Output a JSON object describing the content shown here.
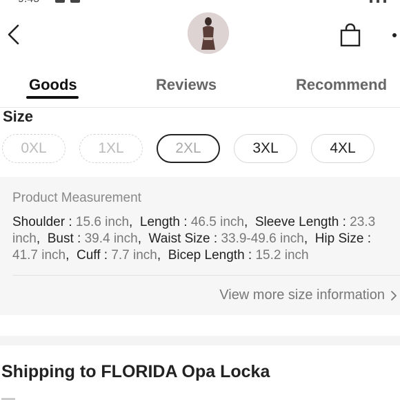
{
  "status_bar": {
    "time": "9:45"
  },
  "header": {
    "back_icon": "chevron-left-icon",
    "avatar_icon": "product-thumbnail",
    "bag_icon": "shopping-bag-icon",
    "more_icon": "more-icon"
  },
  "tabs": [
    {
      "label": "Goods",
      "active": true
    },
    {
      "label": "Reviews",
      "active": false
    },
    {
      "label": "Recommend",
      "active": false
    }
  ],
  "size": {
    "label": "Size",
    "options": [
      {
        "label": "0XL",
        "state": "disabled"
      },
      {
        "label": "1XL",
        "state": "disabled"
      },
      {
        "label": "2XL",
        "state": "selected"
      },
      {
        "label": "3XL",
        "state": "available"
      },
      {
        "label": "4XL",
        "state": "available"
      }
    ]
  },
  "measurement": {
    "title": "Product Measurement",
    "items": [
      {
        "key": "Shoulder",
        "value": "15.6 inch"
      },
      {
        "key": "Length",
        "value": "46.5 inch"
      },
      {
        "key": "Sleeve Length",
        "value": "23.3 inch"
      },
      {
        "key": "Bust",
        "value": "39.4 inch"
      },
      {
        "key": "Waist Size",
        "value": "33.9-49.6 inch"
      },
      {
        "key": "Hip Size",
        "value": "41.7 inch"
      },
      {
        "key": "Cuff",
        "value": "7.7 inch"
      },
      {
        "key": "Bicep Length",
        "value": "15.2 inch"
      }
    ],
    "view_more": "View more size information"
  },
  "shipping": {
    "label": "Shipping to FLORIDA Opa Locka"
  },
  "colors": {
    "text": "#222222",
    "muted": "#777777",
    "panel": "#f6f6f6",
    "accent": "#111111"
  }
}
